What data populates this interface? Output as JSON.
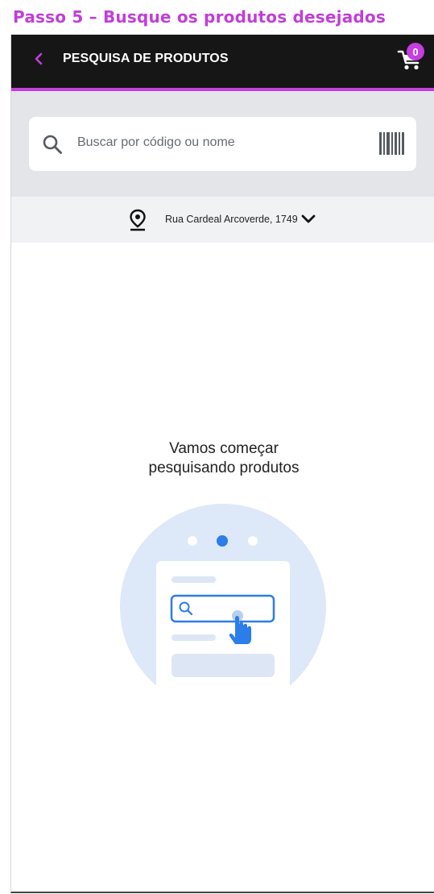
{
  "step_title": "Passo 5 – Busque os produtos desejados",
  "appbar": {
    "title": "PESQUISA DE PRODUTOS",
    "back_icon": "chevron-left-icon",
    "cart_icon": "cart-icon",
    "cart_count": "0"
  },
  "search": {
    "placeholder": "Buscar por código ou nome",
    "icon": "search-icon",
    "barcode_icon": "barcode-icon"
  },
  "address": {
    "text": "Rua Cardeal Arcoverde, 1749",
    "icon": "location-pin-icon",
    "dropdown_icon": "chevron-down-icon"
  },
  "empty_state": {
    "line1": "Vamos começar",
    "line2": "pesquisando produtos"
  },
  "colors": {
    "accent": "#c63de0",
    "appbar_bg": "#161616",
    "search_area_bg": "#e4e5e9",
    "address_bg": "#f1f2f4",
    "illustration_circle": "#dde8f8",
    "illustration_blue": "#2b7de9"
  }
}
